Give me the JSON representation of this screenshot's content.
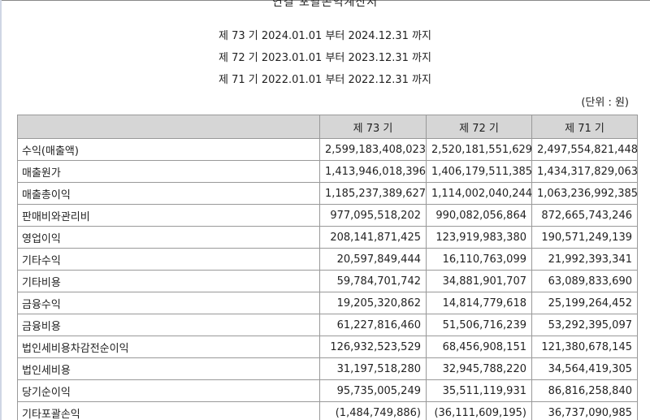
{
  "document": {
    "title": "연결 포괄손익계산서",
    "periods": [
      "제 73 기 2024.01.01 부터 2024.12.31 까지",
      "제 72 기 2023.01.01 부터 2023.12.31 까지",
      "제 71 기 2022.01.01 부터 2022.12.31 까지"
    ],
    "unit": "(단위 : 원)"
  },
  "table": {
    "headers": [
      "",
      "제 73 기",
      "제 72 기",
      "제 71 기"
    ],
    "rows": [
      {
        "label": "수익(매출액)",
        "values": [
          "2,599,183,408,023",
          "2,520,181,551,629",
          "2,497,554,821,448"
        ]
      },
      {
        "label": "매출원가",
        "values": [
          "1,413,946,018,396",
          "1,406,179,511,385",
          "1,434,317,829,063"
        ]
      },
      {
        "label": "매출총이익",
        "values": [
          "1,185,237,389,627",
          "1,114,002,040,244",
          "1,063,236,992,385"
        ]
      },
      {
        "label": "판매비와관리비",
        "values": [
          "977,095,518,202",
          "990,082,056,864",
          "872,665,743,246"
        ]
      },
      {
        "label": "영업이익",
        "values": [
          "208,141,871,425",
          "123,919,983,380",
          "190,571,249,139"
        ]
      },
      {
        "label": "기타수익",
        "values": [
          "20,597,849,444",
          "16,110,763,099",
          "21,992,393,341"
        ]
      },
      {
        "label": "기타비용",
        "values": [
          "59,784,701,742",
          "34,881,901,707",
          "63,089,833,690"
        ]
      },
      {
        "label": "금융수익",
        "values": [
          "19,205,320,862",
          "14,814,779,618",
          "25,199,264,452"
        ]
      },
      {
        "label": "금융비용",
        "values": [
          "61,227,816,460",
          "51,506,716,239",
          "53,292,395,097"
        ]
      },
      {
        "label": "법인세비용차감전순이익",
        "values": [
          "126,932,523,529",
          "68,456,908,151",
          "121,380,678,145"
        ]
      },
      {
        "label": "법인세비용",
        "values": [
          "31,197,518,280",
          "32,945,788,220",
          "34,564,419,305"
        ]
      },
      {
        "label": "당기순이익",
        "values": [
          "95,735,005,249",
          "35,511,119,931",
          "86,816,258,840"
        ]
      },
      {
        "label": "기타포괄손익",
        "values": [
          "(1,484,749,886)",
          "(36,111,609,195)",
          "36,737,090,985"
        ]
      }
    ]
  }
}
